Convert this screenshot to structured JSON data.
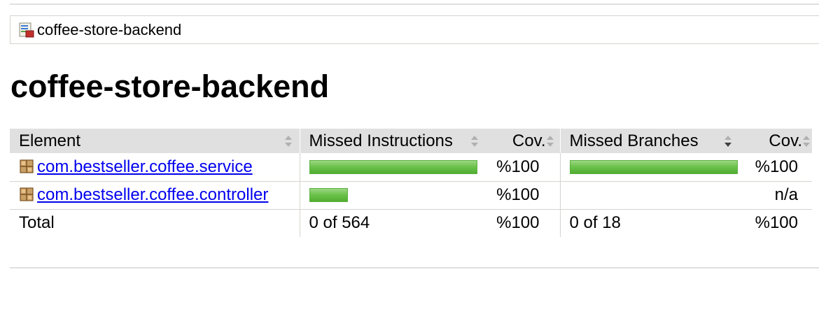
{
  "breadcrumb": {
    "label": "coffee-store-backend",
    "icon": "report-icon"
  },
  "page": {
    "title": "coffee-store-backend"
  },
  "table": {
    "headers": {
      "element": "Element",
      "missed_instructions": "Missed Instructions",
      "cov_instructions": "Cov.",
      "missed_branches": "Missed Branches",
      "cov_branches": "Cov."
    },
    "rows": [
      {
        "element": "com.bestseller.coffee.service",
        "instructions_covered_fraction": 1.0,
        "instructions_bar_relative_width": 1.0,
        "cov_instructions": "%100",
        "branches_covered_fraction": 1.0,
        "branches_bar_relative_width": 1.0,
        "cov_branches": "%100"
      },
      {
        "element": "com.bestseller.coffee.controller",
        "instructions_covered_fraction": 1.0,
        "instructions_bar_relative_width": 0.23,
        "cov_instructions": "%100",
        "branches_covered_fraction": null,
        "branches_bar_relative_width": 0,
        "cov_branches": "n/a"
      }
    ],
    "total": {
      "label": "Total",
      "missed_instructions": "0 of 564",
      "cov_instructions": "%100",
      "missed_branches": "0 of 18",
      "cov_branches": "%100"
    }
  },
  "colors": {
    "bar_green": "#6ec34d",
    "header_bg": "#e0e0e0",
    "link": "#0000ee"
  }
}
